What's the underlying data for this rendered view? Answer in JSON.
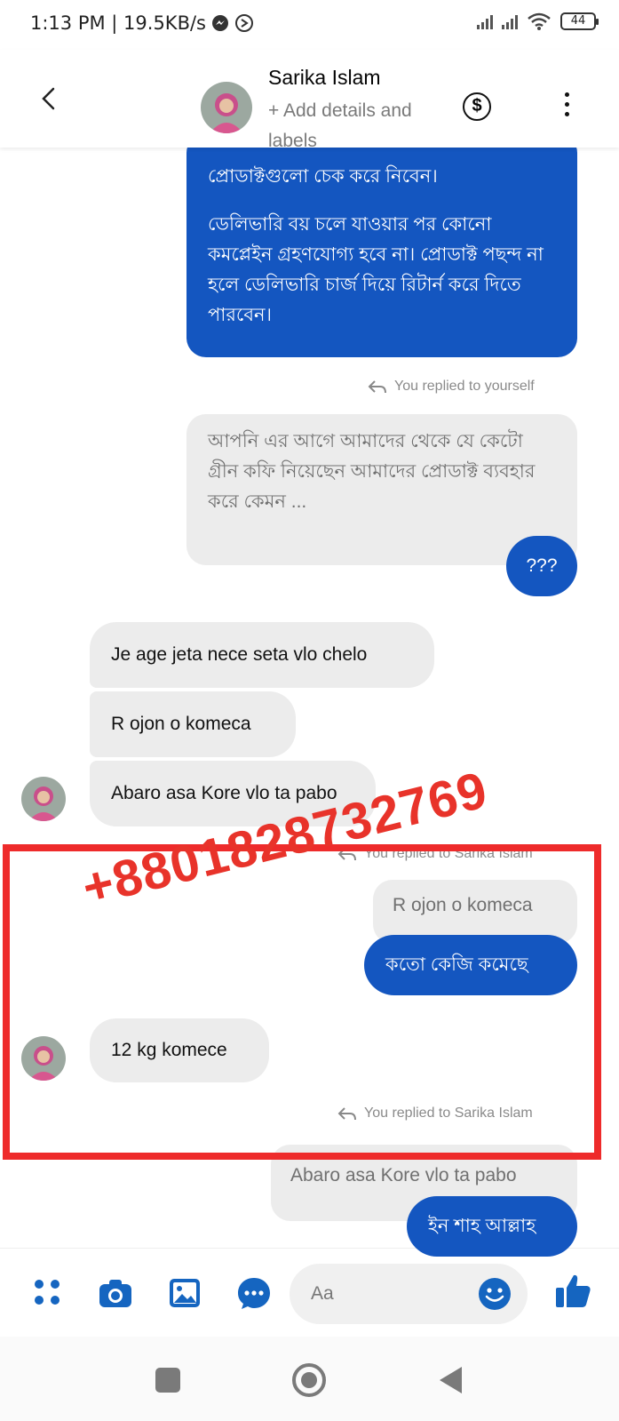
{
  "status_bar": {
    "time_speed": "1:13 PM | 19.5KB/s",
    "battery": "44"
  },
  "header": {
    "contact_name": "Sarika Islam",
    "subtitle": "+ Add details and labels"
  },
  "messages": {
    "out_long_line1": "প্রোডাক্টগুলো চেক করে নিবেন।",
    "out_long_para2": "ডেলিভারি বয় চলে যাওয়ার পর কোনো কমপ্লেইন গ্রহণযোগ্য হবে না। প্রোডাক্ট পছন্দ না হলে ডেলিভারি চার্জ দিয়ে রিটার্ন করে দিতে পারবেন।",
    "reply_note_1": "You replied to yourself",
    "quoted_1": "আপনি এর আগে আমাদের থেকে যে কেটো গ্রীন কফি নিয়েছেন আমাদের প্রোডাক্ট ব্যবহার করে কেমন ...",
    "out_question": "???",
    "in_1": "Je age jeta nece seta vlo chelo",
    "in_2": "R ojon o komeca",
    "in_3": "Abaro asa Kore vlo ta pabo",
    "reply_note_2": "You replied to Sarika Islam",
    "quoted_2": "R ojon o komeca",
    "out_weight": "কতো কেজি কমেছে",
    "in_4": "12 kg komece",
    "reply_note_3": "You replied to Sarika Islam",
    "quoted_3": "Abaro asa Kore vlo ta pabo",
    "out_last": "ইন শাহ আল্লাহ"
  },
  "watermark": "+8801828732769",
  "composer": {
    "placeholder": "Aa"
  },
  "colors": {
    "accent": "#1456c0",
    "incoming_bg": "#ececec",
    "highlight": "#ee2b2b",
    "watermark": "#e8332a"
  }
}
